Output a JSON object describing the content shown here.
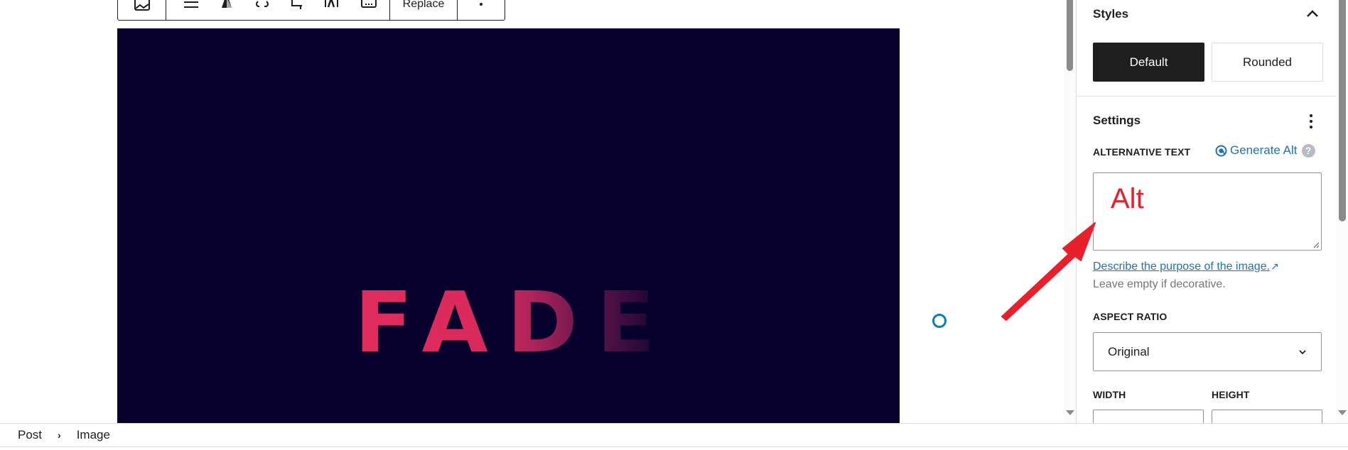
{
  "toolbar": {
    "buttons": [
      {
        "name": "image-type-button",
        "icon": "image-icon"
      },
      {
        "name": "align-button",
        "icon": "align-icon"
      },
      {
        "name": "duotone-button",
        "icon": "duotone-icon"
      },
      {
        "name": "link-button",
        "icon": "link-icon"
      },
      {
        "name": "crop-button",
        "icon": "crop-icon"
      },
      {
        "name": "text-over-image-button",
        "icon": "text-over-image-icon"
      },
      {
        "name": "keyboard-button",
        "icon": "keyboard-icon"
      }
    ],
    "replace_label": "Replace",
    "more_icon": "more-vertical-icon"
  },
  "image": {
    "caption_text": "FADE",
    "background_color": "#07002d",
    "text_color": "#e12c5c"
  },
  "sidebar": {
    "styles": {
      "title": "Styles",
      "options": [
        {
          "label": "Default",
          "selected": true
        },
        {
          "label": "Rounded",
          "selected": false
        }
      ]
    },
    "settings": {
      "title": "Settings",
      "alt_text": {
        "label": "ALTERNATIVE TEXT",
        "generate_label": "Generate Alt",
        "help_glyph": "?",
        "value": "Alt",
        "help_link": "Describe the purpose of the image.",
        "help_link_arrow": "↗",
        "hint": "Leave empty if decorative."
      },
      "aspect_ratio": {
        "label": "ASPECT RATIO",
        "value": "Original"
      },
      "width": {
        "label": "WIDTH",
        "value": ""
      },
      "height": {
        "label": "HEIGHT",
        "value": ""
      }
    }
  },
  "breadcrumb": {
    "items": [
      "Post",
      "Image"
    ],
    "separator": "›"
  },
  "colors": {
    "accent": "#2271b1",
    "primary_button": "#1e1e1e",
    "annotation": "#e8202b",
    "insert_point": "#0a7bc4"
  }
}
